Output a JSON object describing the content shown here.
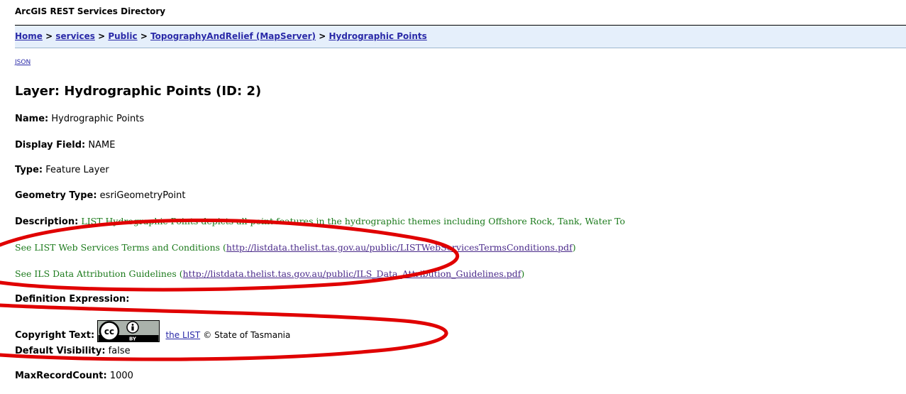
{
  "app_title": "ArcGIS REST Services Directory",
  "breadcrumb": {
    "items": [
      {
        "label": "Home"
      },
      {
        "label": "services"
      },
      {
        "label": "Public"
      },
      {
        "label": "TopographyAndRelief (MapServer)"
      },
      {
        "label": "Hydrographic Points"
      }
    ],
    "separator": ">"
  },
  "json_link": "JSON",
  "page_title": "Layer: Hydrographic Points (ID: 2)",
  "properties": {
    "name": {
      "label": "Name:",
      "value": "Hydrographic Points"
    },
    "display_field": {
      "label": "Display Field:",
      "value": "NAME"
    },
    "type": {
      "label": "Type:",
      "value": "Feature Layer"
    },
    "geometry_type": {
      "label": "Geometry Type:",
      "value": "esriGeometryPoint"
    },
    "description": {
      "label": "Description:",
      "value": "LIST Hydrographic Points depicts all point features in the hydrographic themes including Offshore Rock, Tank, Water To"
    },
    "terms": {
      "prefix": "See LIST Web Services Terms and Conditions (",
      "link": "http://listdata.thelist.tas.gov.au/public/LISTWebServicesTermsConditions.pdf",
      "suffix": ")"
    },
    "attribution": {
      "prefix": "See ILS Data Attribution Guidelines (",
      "link": "http://listdata.thelist.tas.gov.au/public/ILS_Data_Attribution_Guidelines.pdf",
      "suffix": ")"
    },
    "definition_expression": {
      "label": "Definition Expression:",
      "value": ""
    },
    "copyright": {
      "label": "Copyright Text:",
      "badge_text": "BY",
      "link": "the LIST",
      "rest": "© State of Tasmania"
    },
    "default_visibility": {
      "label": "Default Visibility:",
      "value": "false"
    },
    "max_record_count": {
      "label": "MaxRecordCount:",
      "value": "1000"
    }
  },
  "colors": {
    "link": "#2a2aa8",
    "description_green": "#1b7a1b",
    "breadcrumb_bg": "#e5effb",
    "annotation_red": "#e00000"
  }
}
